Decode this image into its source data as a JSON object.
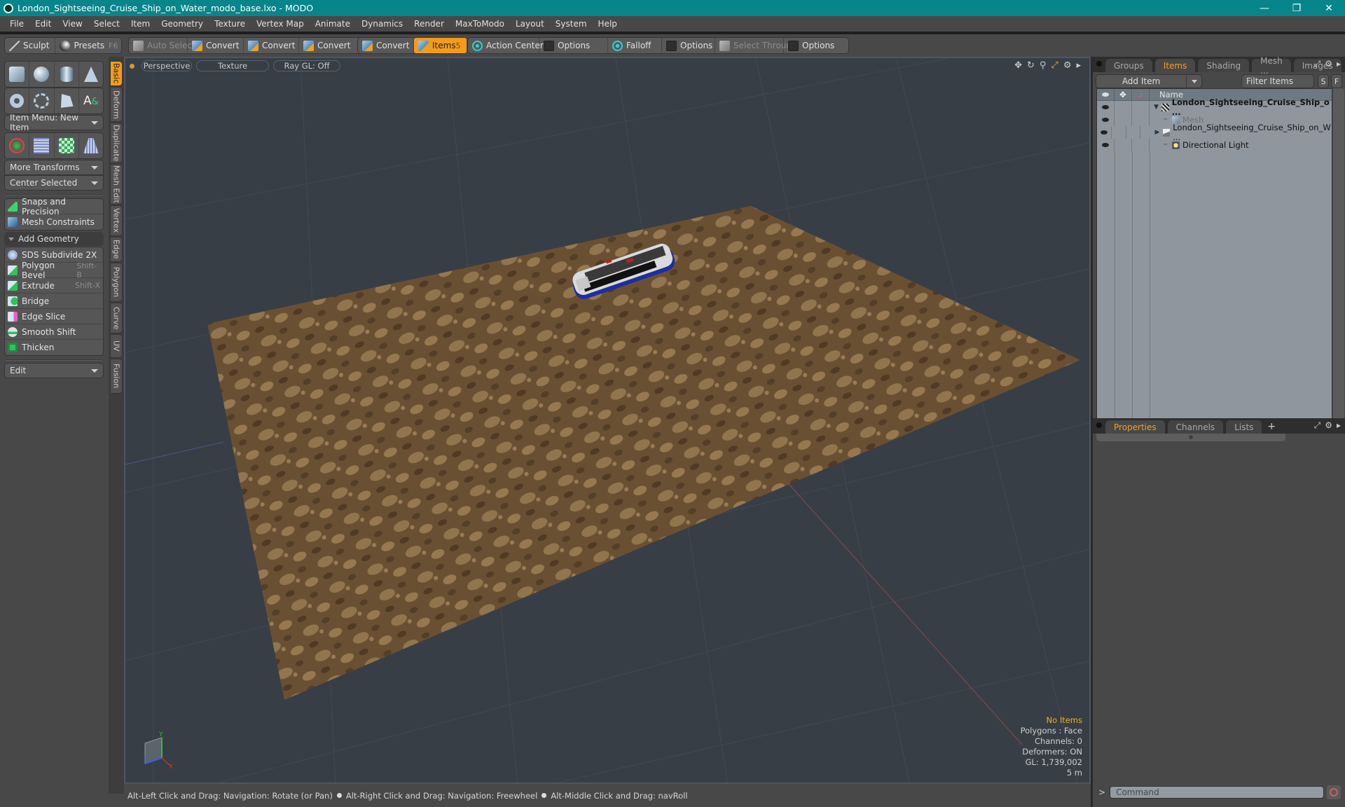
{
  "window": {
    "title": "London_Sightseeing_Cruise_Ship_on_Water_modo_base.lxo - MODO",
    "controls": [
      "—",
      "❐",
      "✕"
    ]
  },
  "menubar": [
    "File",
    "Edit",
    "View",
    "Select",
    "Item",
    "Geometry",
    "Texture",
    "Vertex Map",
    "Animate",
    "Dynamics",
    "Render",
    "MaxToModo",
    "Layout",
    "System",
    "Help"
  ],
  "toolbar": {
    "sculpt": "Sculpt",
    "presets": "Presets",
    "presets_key": "F6",
    "auto_select": "Auto Select",
    "convert1": "Convert",
    "convert2": "Convert",
    "convert3": "Convert",
    "convert4": "Convert",
    "items": "Items",
    "items_count": "5",
    "action_center": "Action Center",
    "options1": "Options",
    "falloff": "Falloff",
    "options2": "Options",
    "select_through": "Select Through",
    "options3": "Options"
  },
  "left_panel": {
    "item_menu": "Item Menu: New Item",
    "more_transforms": "More Transforms",
    "center_selected": "Center Selected",
    "snaps": "Snaps and Precision",
    "mesh_constraints": "Mesh Constraints",
    "add_geometry": "Add Geometry",
    "tools": [
      {
        "label": "SDS Subdivide 2X",
        "key": ""
      },
      {
        "label": "Polygon Bevel",
        "key": "Shift-B"
      },
      {
        "label": "Extrude",
        "key": "Shift-X"
      },
      {
        "label": "Bridge",
        "key": ""
      },
      {
        "label": "Edge Slice",
        "key": ""
      },
      {
        "label": "Smooth Shift",
        "key": ""
      },
      {
        "label": "Thicken",
        "key": ""
      }
    ],
    "edit_dropdown": "Edit",
    "vertical_tabs": [
      "Basic",
      "Deform",
      "Duplicate",
      "Mesh Edit",
      "Vertex",
      "Edge",
      "Polygon",
      "Curve",
      "UV",
      "Fusion"
    ]
  },
  "viewport": {
    "view_mode": "Perspective",
    "shading": "Texture",
    "raygl": "Ray GL: Off",
    "info": {
      "selection": "No Items",
      "polygons": "Polygons : Face",
      "channels": "Channels: 0",
      "deformers": "Deformers: ON",
      "gl": "GL: 1,739,002",
      "scale": "5 m"
    },
    "axis_labels": {
      "x": "X",
      "y": "Y",
      "z": "Z"
    }
  },
  "statusbar": {
    "hint1": "Alt-Left Click and Drag: Navigation: Rotate (or Pan)",
    "hint2": "Alt-Right Click and Drag: Navigation: Freewheel",
    "hint3": "Alt-Middle Click and Drag: navRoll"
  },
  "right_panel": {
    "tabs": [
      "Groups",
      "Items",
      "Shading",
      "Mesh ...",
      "Images"
    ],
    "active_tab": "Items",
    "add_item": "Add Item",
    "filter_placeholder": "Filter Items",
    "s_btn": "S",
    "f_btn": "F",
    "list_header": {
      "name": "Name"
    },
    "items": [
      {
        "name": "London_Sightseeing_Cruise_Ship_o ...",
        "type": "scene",
        "bold": true
      },
      {
        "name": "Mesh",
        "type": "mesh",
        "dim": true
      },
      {
        "name": "London_Sightseeing_Cruise_Ship_on_W ...",
        "type": "group"
      },
      {
        "name": "Directional Light",
        "type": "light"
      }
    ],
    "bottom_tabs": [
      "Properties",
      "Channels",
      "Lists"
    ],
    "bottom_active": "Properties",
    "command_placeholder": "Command"
  },
  "colors": {
    "titlebar": "#06868a",
    "accent": "#f39c1c",
    "viewport_bg": "#383e45",
    "ground": "#6e5535"
  }
}
